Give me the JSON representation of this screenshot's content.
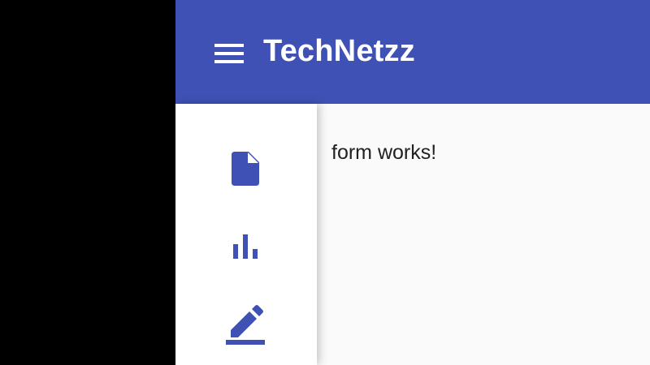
{
  "toolbar": {
    "brand": "TechNetzz",
    "menu_icon": "menu-icon",
    "background_color": "#3f51b5"
  },
  "sidenav": {
    "items": [
      {
        "icon": "file-icon",
        "color": "#3f51b5"
      },
      {
        "icon": "bar-chart-icon",
        "color": "#3f51b5"
      },
      {
        "icon": "edit-icon",
        "color": "#3f51b5"
      }
    ]
  },
  "content": {
    "text": "form works!"
  }
}
